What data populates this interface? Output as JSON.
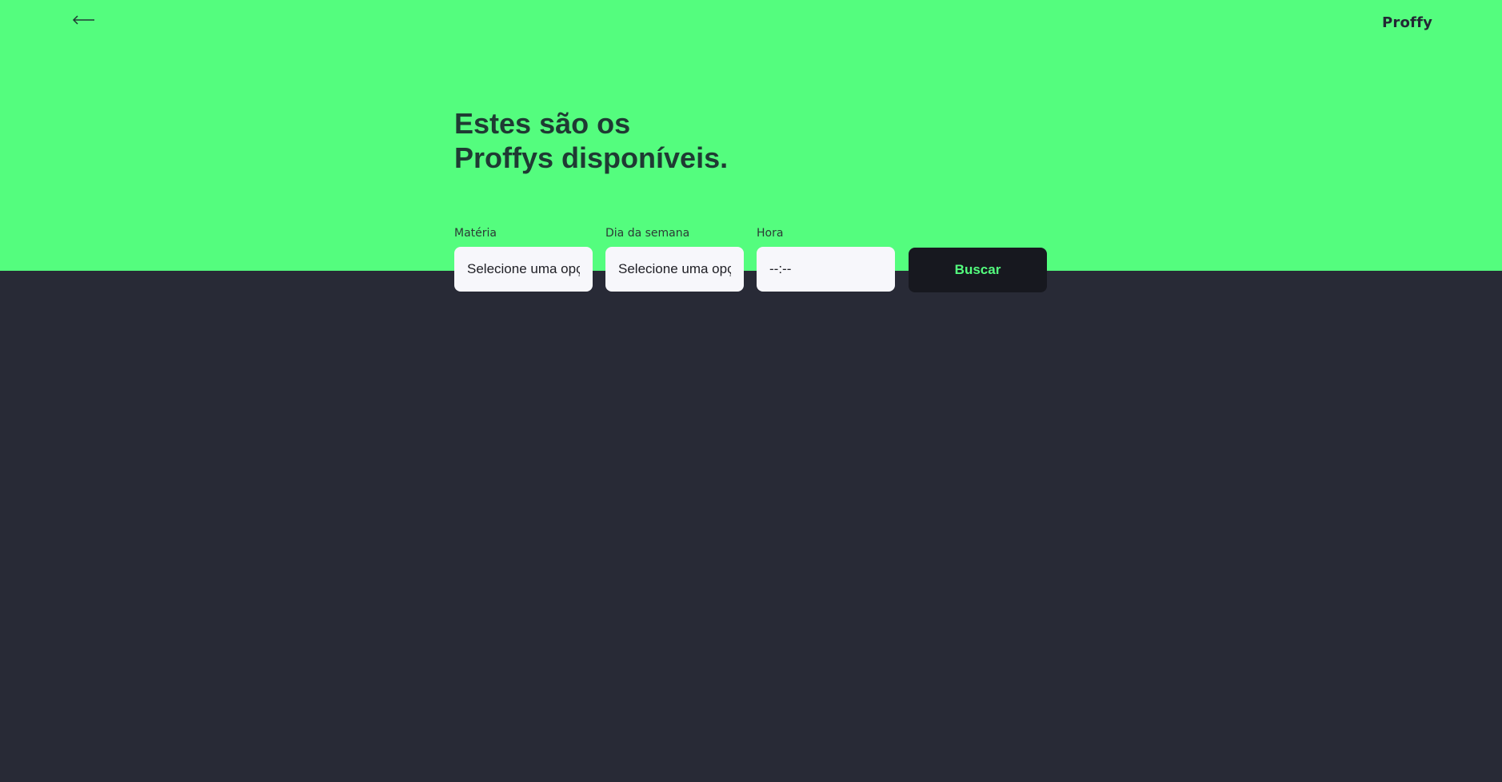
{
  "header": {
    "back_icon": "arrow-left-icon",
    "logo_text": "Proffy",
    "accent_color": "#54fd7e",
    "background_color": "#282a36"
  },
  "page": {
    "title_line1": "Estes são os",
    "title_line2": "Proffys disponíveis."
  },
  "filters": {
    "subject": {
      "label": "Matéria",
      "value": "Selecione uma opção"
    },
    "weekday": {
      "label": "Dia da semana",
      "value": "Selecione uma opção"
    },
    "time": {
      "label": "Hora",
      "value": "--:--"
    },
    "submit_label": "Buscar"
  }
}
